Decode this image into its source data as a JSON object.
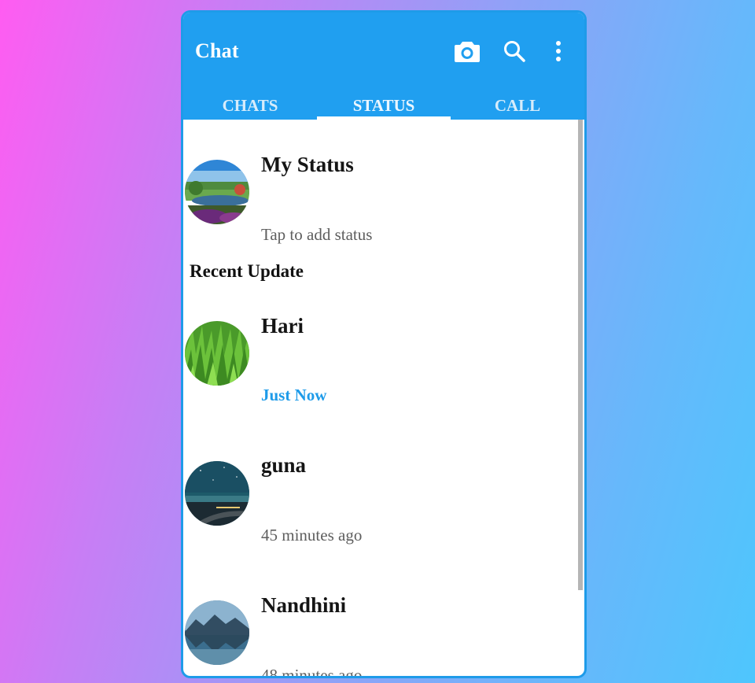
{
  "app": {
    "title": "Chat"
  },
  "toolbar": {
    "icons": [
      "camera-icon",
      "search-icon",
      "more-vert-icon"
    ]
  },
  "tabs": [
    {
      "label": "CHATS",
      "active": false
    },
    {
      "label": "STATUS",
      "active": true
    },
    {
      "label": "CALL",
      "active": false
    }
  ],
  "my_status": {
    "name": "My Status",
    "subtitle": "Tap to add status"
  },
  "recent": {
    "heading": "Recent Update",
    "items": [
      {
        "name": "Hari",
        "time": "Just Now"
      },
      {
        "name": "guna",
        "time": "45 minutes ago"
      },
      {
        "name": "Nandhini",
        "time": "48 minutes ago"
      }
    ]
  },
  "colors": {
    "primary": "#209ff0",
    "accent_text": "#1e9be9",
    "border": "#1e9be9"
  }
}
